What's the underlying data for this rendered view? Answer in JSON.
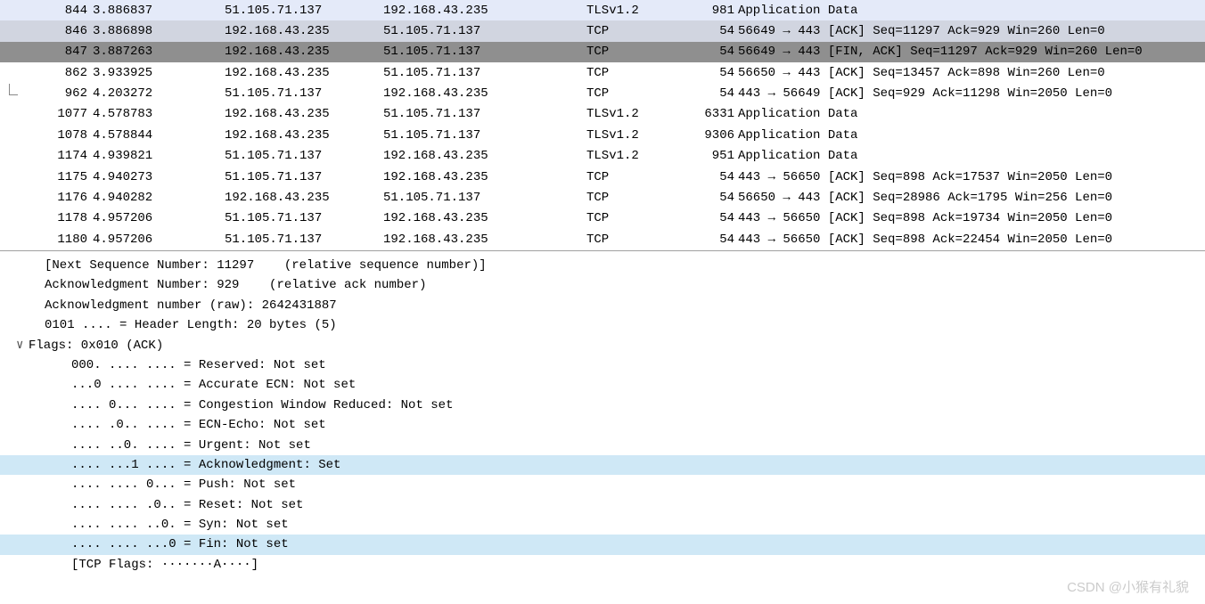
{
  "packets": [
    {
      "no": "844",
      "time": "3.886837",
      "src": "51.105.71.137",
      "dst": "192.168.43.235",
      "proto": "TLSv1.2",
      "len": "981",
      "info": "Application Data",
      "cls": "alt"
    },
    {
      "no": "846",
      "time": "3.886898",
      "src": "192.168.43.235",
      "dst": "51.105.71.137",
      "proto": "TCP",
      "len": "54",
      "info": "56649 → 443 [ACK] Seq=11297 Ack=929 Win=260 Len=0",
      "cls": "light-sel"
    },
    {
      "no": "847",
      "time": "3.887263",
      "src": "192.168.43.235",
      "dst": "51.105.71.137",
      "proto": "TCP",
      "len": "54",
      "info": "56649 → 443 [FIN, ACK] Seq=11297 Ack=929 Win=260 Len=0",
      "cls": "selected"
    },
    {
      "no": "862",
      "time": "3.933925",
      "src": "192.168.43.235",
      "dst": "51.105.71.137",
      "proto": "TCP",
      "len": "54",
      "info": "56650 → 443 [ACK] Seq=13457 Ack=898 Win=260 Len=0",
      "cls": "normal"
    },
    {
      "no": "962",
      "time": "4.203272",
      "src": "51.105.71.137",
      "dst": "192.168.43.235",
      "proto": "TCP",
      "len": "54",
      "info": "443 → 56649 [ACK] Seq=929 Ack=11298 Win=2050 Len=0",
      "cls": "normal",
      "tree": true
    },
    {
      "no": "1077",
      "time": "4.578783",
      "src": "192.168.43.235",
      "dst": "51.105.71.137",
      "proto": "TLSv1.2",
      "len": "6331",
      "info": "Application Data",
      "cls": "normal"
    },
    {
      "no": "1078",
      "time": "4.578844",
      "src": "192.168.43.235",
      "dst": "51.105.71.137",
      "proto": "TLSv1.2",
      "len": "9306",
      "info": "Application Data",
      "cls": "normal"
    },
    {
      "no": "1174",
      "time": "4.939821",
      "src": "51.105.71.137",
      "dst": "192.168.43.235",
      "proto": "TLSv1.2",
      "len": "951",
      "info": "Application Data",
      "cls": "normal"
    },
    {
      "no": "1175",
      "time": "4.940273",
      "src": "51.105.71.137",
      "dst": "192.168.43.235",
      "proto": "TCP",
      "len": "54",
      "info": "443 → 56650 [ACK] Seq=898 Ack=17537 Win=2050 Len=0",
      "cls": "normal"
    },
    {
      "no": "1176",
      "time": "4.940282",
      "src": "192.168.43.235",
      "dst": "51.105.71.137",
      "proto": "TCP",
      "len": "54",
      "info": "56650 → 443 [ACK] Seq=28986 Ack=1795 Win=256 Len=0",
      "cls": "normal"
    },
    {
      "no": "1178",
      "time": "4.957206",
      "src": "51.105.71.137",
      "dst": "192.168.43.235",
      "proto": "TCP",
      "len": "54",
      "info": "443 → 56650 [ACK] Seq=898 Ack=19734 Win=2050 Len=0",
      "cls": "normal"
    },
    {
      "no": "1180",
      "time": "4.957206",
      "src": "51.105.71.137",
      "dst": "192.168.43.235",
      "proto": "TCP",
      "len": "54",
      "info": "443 → 56650 [ACK] Seq=898 Ack=22454 Win=2050 Len=0",
      "cls": "normal"
    }
  ],
  "detail": {
    "lines": [
      {
        "lvl": 1,
        "hl": false,
        "exp": "",
        "text": "[Next Sequence Number: 11297    (relative sequence number)]"
      },
      {
        "lvl": 1,
        "hl": false,
        "exp": "",
        "text": "Acknowledgment Number: 929    (relative ack number)"
      },
      {
        "lvl": 1,
        "hl": false,
        "exp": "",
        "text": "Acknowledgment number (raw): 2642431887"
      },
      {
        "lvl": 1,
        "hl": false,
        "exp": "",
        "text": "0101 .... = Header Length: 20 bytes (5)"
      },
      {
        "lvl": 0,
        "hl": false,
        "exp": "v",
        "text": "Flags: 0x010 (ACK)"
      },
      {
        "lvl": 2,
        "hl": false,
        "exp": "",
        "text": "000. .... .... = Reserved: Not set"
      },
      {
        "lvl": 2,
        "hl": false,
        "exp": "",
        "text": "...0 .... .... = Accurate ECN: Not set"
      },
      {
        "lvl": 2,
        "hl": false,
        "exp": "",
        "text": ".... 0... .... = Congestion Window Reduced: Not set"
      },
      {
        "lvl": 2,
        "hl": false,
        "exp": "",
        "text": ".... .0.. .... = ECN-Echo: Not set"
      },
      {
        "lvl": 2,
        "hl": false,
        "exp": "",
        "text": ".... ..0. .... = Urgent: Not set"
      },
      {
        "lvl": 2,
        "hl": true,
        "exp": "",
        "text": ".... ...1 .... = Acknowledgment: Set"
      },
      {
        "lvl": 2,
        "hl": false,
        "exp": "",
        "text": ".... .... 0... = Push: Not set"
      },
      {
        "lvl": 2,
        "hl": false,
        "exp": "",
        "text": ".... .... .0.. = Reset: Not set"
      },
      {
        "lvl": 2,
        "hl": false,
        "exp": "",
        "text": ".... .... ..0. = Syn: Not set"
      },
      {
        "lvl": 2,
        "hl": true,
        "exp": "",
        "text": ".... .... ...0 = Fin: Not set"
      },
      {
        "lvl": 2,
        "hl": false,
        "exp": "",
        "text": "[TCP Flags: ·······A····]"
      }
    ]
  },
  "watermark": "CSDN @小猴有礼貌"
}
